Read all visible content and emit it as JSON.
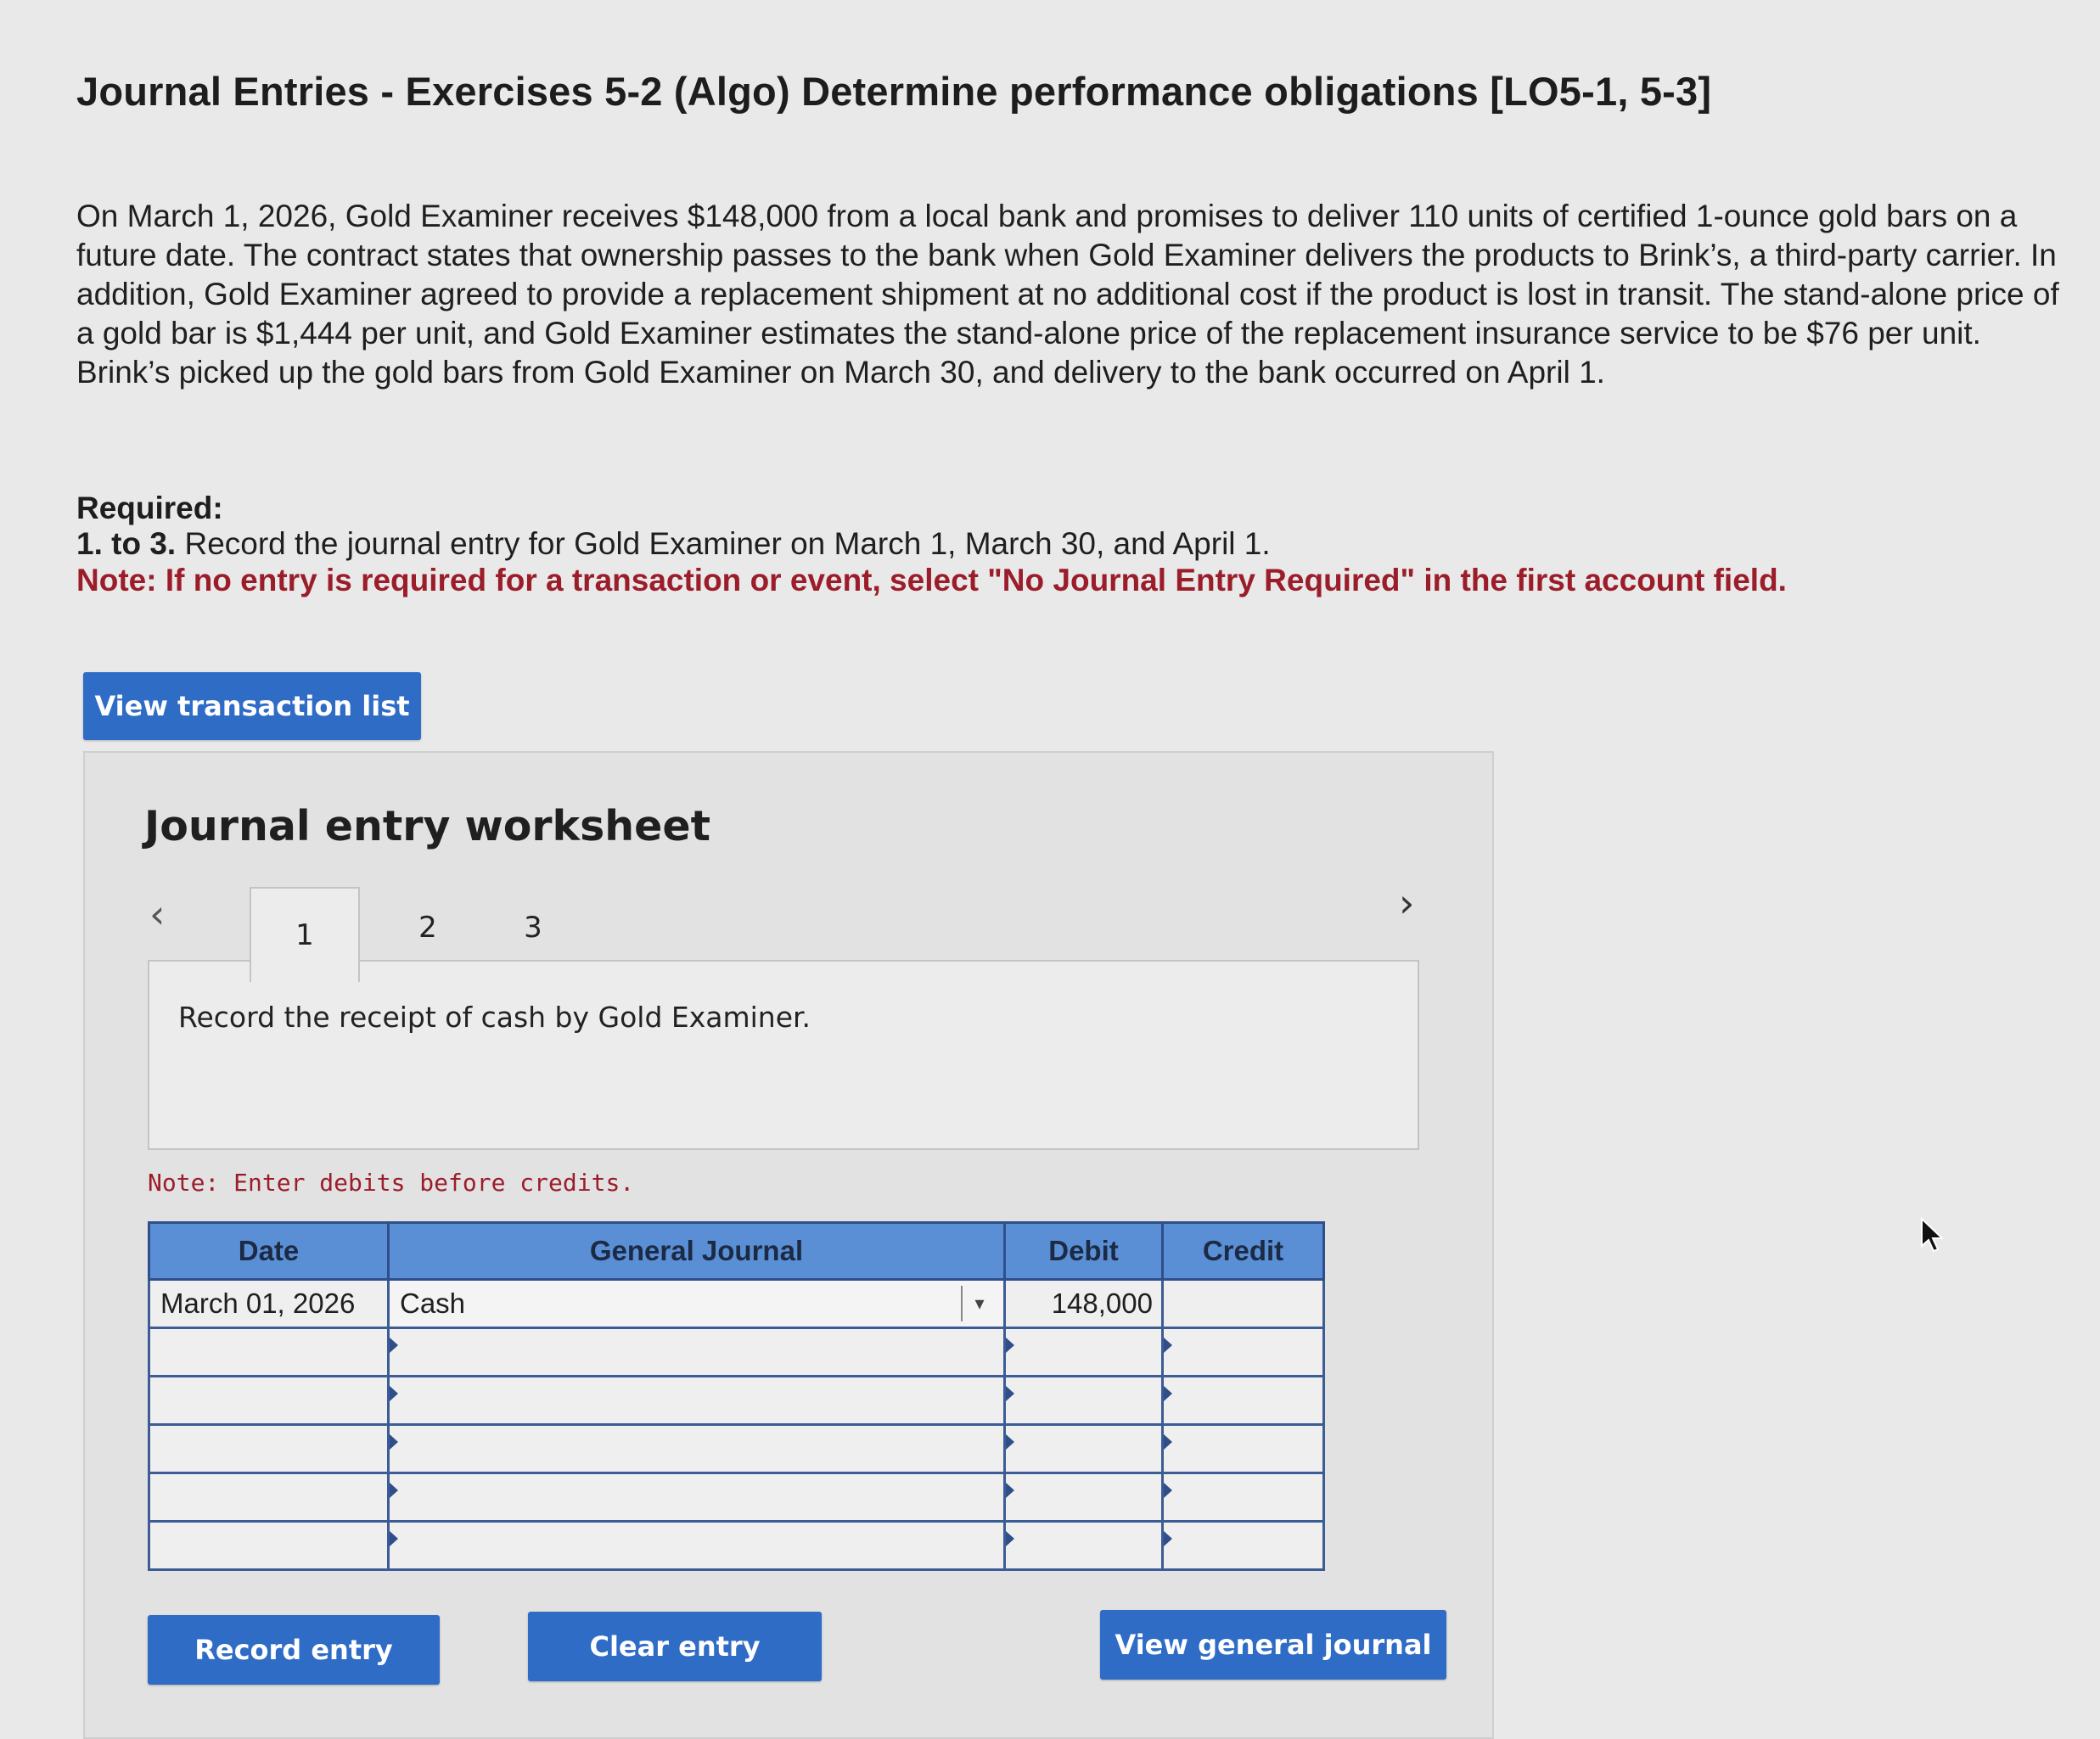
{
  "header": {
    "title": "Journal Entries - Exercises 5-2 (Algo) Determine performance obligations [LO5-1, 5-3]"
  },
  "problem": {
    "text": "On March 1, 2026, Gold Examiner receives $148,000 from a local bank and promises to deliver 110 units of certified 1-ounce gold bars on a future date. The contract states that ownership passes to the bank when Gold Examiner delivers the products to Brink’s, a third-party carrier. In addition, Gold Examiner agreed to provide a replacement shipment at no additional cost if the product is lost in transit. The stand-alone price of a gold bar is $1,444 per unit, and Gold Examiner estimates the stand-alone price of the replacement insurance service to be $76 per unit. Brink’s picked up the gold bars from Gold Examiner on March 30, and delivery to the bank occurred on April 1."
  },
  "required": {
    "heading": "Required:",
    "item_number": "1. to 3.",
    "item_text": "Record the journal entry for Gold Examiner on March 1, March 30, and April 1.",
    "note": "Note: If no entry is required for a transaction or event, select \"No Journal Entry Required\" in the first account field."
  },
  "buttons": {
    "view_transaction_list": "View transaction list",
    "record_entry": "Record entry",
    "clear_entry": "Clear entry",
    "view_general_journal": "View general journal"
  },
  "worksheet": {
    "title": "Journal entry worksheet",
    "tabs": [
      "1",
      "2",
      "3"
    ],
    "active_tab": "1",
    "instruction": "Record the receipt of cash by Gold Examiner.",
    "note": "Note: Enter debits before credits.",
    "columns": {
      "date": "Date",
      "general_journal": "General Journal",
      "debit": "Debit",
      "credit": "Credit"
    },
    "rows": [
      {
        "date": "March 01, 2026",
        "account": "Cash",
        "debit": "148,000",
        "credit": ""
      },
      {
        "date": "",
        "account": "",
        "debit": "",
        "credit": ""
      },
      {
        "date": "",
        "account": "",
        "debit": "",
        "credit": ""
      },
      {
        "date": "",
        "account": "",
        "debit": "",
        "credit": ""
      },
      {
        "date": "",
        "account": "",
        "debit": "",
        "credit": ""
      },
      {
        "date": "",
        "account": "",
        "debit": "",
        "credit": ""
      }
    ]
  },
  "icons": {
    "prev": "chevron-left-icon",
    "next": "chevron-right-icon",
    "dropdown": "chevron-down-icon",
    "cursor": "mouse-pointer-icon"
  },
  "colors": {
    "button_blue": "#2f6cc6",
    "table_header_blue": "#5a8fd6",
    "note_red": "#9b1d2a"
  }
}
